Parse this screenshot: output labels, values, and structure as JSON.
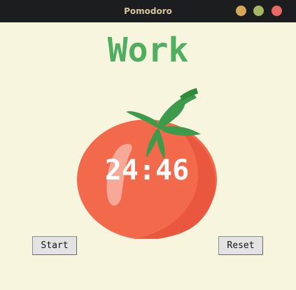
{
  "window": {
    "title": "Pomodoro",
    "controls": {
      "minimize_color": "#d8a657",
      "maximize_color": "#a9b665",
      "close_color": "#ea6962"
    }
  },
  "main": {
    "heading": "Work",
    "timer": "24:46",
    "start_label": "Start",
    "reset_label": "Reset"
  },
  "colors": {
    "background": "#f7f5dd",
    "heading": "#4fae60",
    "tomato": "#f26a4b",
    "leaves": "#3d9a4a"
  }
}
